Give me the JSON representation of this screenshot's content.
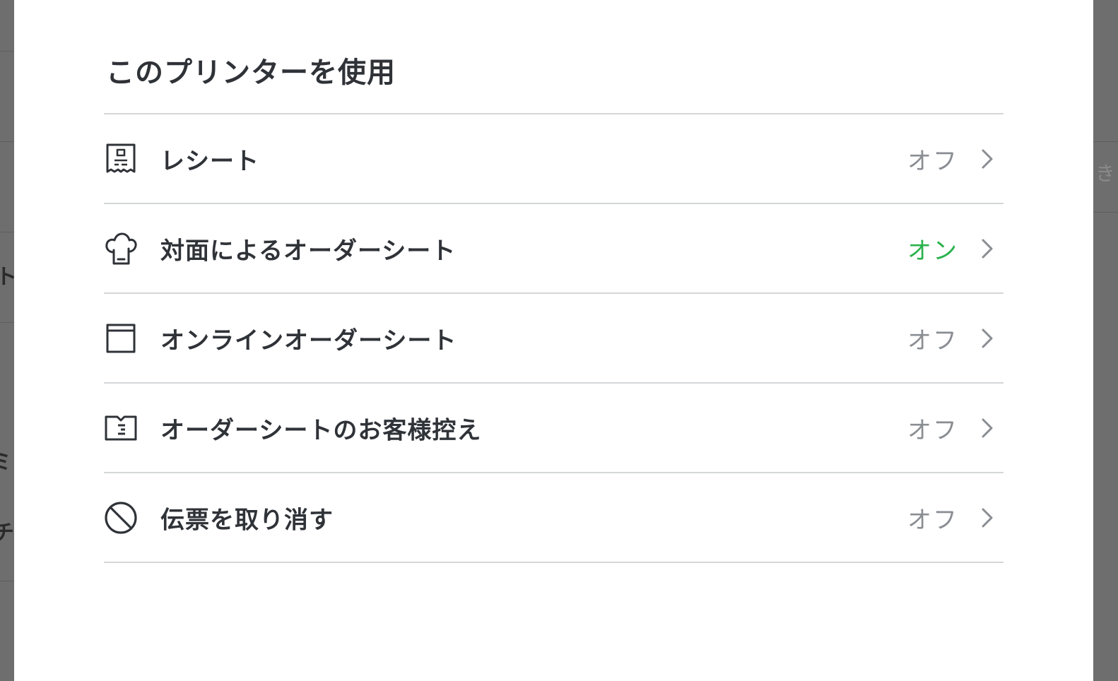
{
  "background": {
    "glyphs": [
      "ト",
      "ミ",
      "チ",
      "き"
    ]
  },
  "dialog": {
    "title": "このプリンターを使用",
    "rows": [
      {
        "icon": "receipt-icon",
        "label": "レシート",
        "status": "オフ",
        "status_on": false
      },
      {
        "icon": "chef-hat-icon",
        "label": "対面によるオーダーシート",
        "status": "オン",
        "status_on": true
      },
      {
        "icon": "browser-window-icon",
        "label": "オンラインオーダーシート",
        "status": "オフ",
        "status_on": false
      },
      {
        "icon": "ticket-icon",
        "label": "オーダーシートのお客様控え",
        "status": "オフ",
        "status_on": false
      },
      {
        "icon": "cancel-icon",
        "label": "伝票を取り消す",
        "status": "オフ",
        "status_on": false
      }
    ],
    "colors": {
      "text": "#2f3338",
      "status_off": "#8a8e93",
      "status_on": "#2bb24c",
      "divider": "#d4d6d8"
    }
  }
}
